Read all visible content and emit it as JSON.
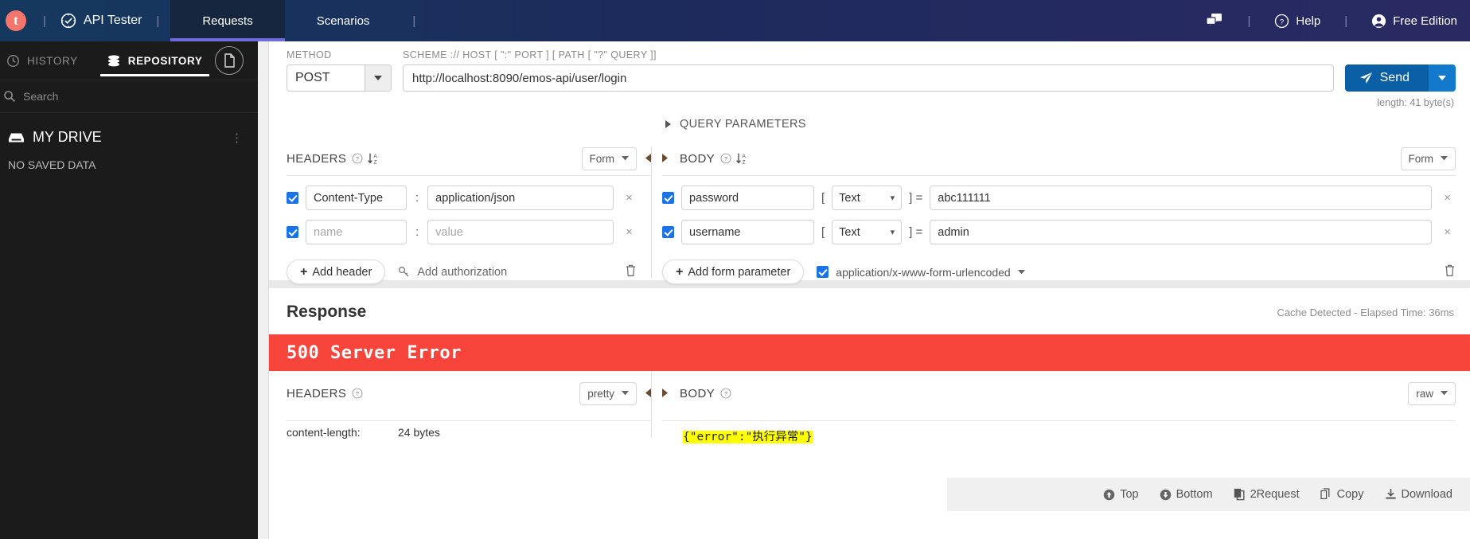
{
  "topnav": {
    "logo_letter": "t",
    "brand": "API Tester",
    "tabs": [
      {
        "label": "Requests",
        "active": true
      },
      {
        "label": "Scenarios",
        "active": false
      }
    ],
    "separator": "|",
    "help_label": "Help",
    "account_label": "Free Edition",
    "chat_icon": "chat-icon",
    "help_icon": "question-circle-icon",
    "account_icon": "user-circle-icon"
  },
  "sidebar": {
    "tabs": [
      {
        "label": "HISTORY",
        "icon": "clock-icon",
        "active": false
      },
      {
        "label": "REPOSITORY",
        "icon": "database-icon",
        "active": true
      }
    ],
    "doc_button_icon": "document-icon",
    "search_placeholder": "Search",
    "search_icon": "search-icon",
    "drive_label": "MY DRIVE",
    "drive_icon": "drive-icon",
    "drive_menu_icon": "kebab-menu-icon",
    "empty_label": "NO SAVED DATA"
  },
  "request": {
    "method_label": "METHOD",
    "method_value": "POST",
    "url_label": "SCHEME :// HOST [ \":\" PORT ] [ PATH [ \"?\" QUERY ]]",
    "url_value": "http://localhost:8090/emos-api/user/login",
    "send_label": "Send",
    "send_icon": "paper-plane-icon",
    "length_note": "length: 41 byte(s)",
    "query_params_label": "QUERY PARAMETERS",
    "query_params_icon": "triangle-right-icon"
  },
  "headers_panel": {
    "title": "HEADERS",
    "help_icon": "question-circle-icon",
    "sort_icon": "sort-az-icon",
    "view_mode": "Form",
    "collapse_icon": "triangle-left-icon",
    "rows": [
      {
        "checked": true,
        "name": "Content-Type",
        "value": "application/json",
        "name_is_placeholder": false,
        "value_is_placeholder": false,
        "remove": "×"
      },
      {
        "checked": true,
        "name": "name",
        "value": "value",
        "name_is_placeholder": true,
        "value_is_placeholder": true,
        "remove": "×"
      }
    ],
    "separator": ":",
    "add_label": "Add header",
    "add_auth_label": "Add authorization",
    "add_auth_icon": "key-icon",
    "trash_icon": "trash-icon"
  },
  "body_panel": {
    "title": "BODY",
    "help_icon": "question-circle-icon",
    "sort_icon": "sort-az-icon",
    "view_mode": "Form",
    "expand_icon": "triangle-right-icon",
    "rows": [
      {
        "checked": true,
        "name": "password",
        "type": "Text",
        "value": "abc111111",
        "remove": "×"
      },
      {
        "checked": true,
        "name": "username",
        "type": "Text",
        "value": "admin",
        "remove": "×"
      }
    ],
    "bracket_open": "[",
    "bracket_close": "] =",
    "add_label": "Add form parameter",
    "content_type_checked": true,
    "content_type": "application/x-www-form-urlencoded",
    "trash_icon": "trash-icon"
  },
  "response": {
    "title": "Response",
    "cache_note": "Cache Detected - Elapsed Time: 36ms",
    "status_banner": "500 Server Error",
    "status_color": "#f8453c",
    "headers": {
      "title": "HEADERS",
      "help_icon": "question-circle-icon",
      "view_mode": "pretty",
      "collapse_icon": "triangle-left-icon",
      "rows": [
        {
          "key": "content-length:",
          "value": "24 bytes"
        }
      ]
    },
    "body": {
      "title": "BODY",
      "help_icon": "question-circle-icon",
      "view_mode": "raw",
      "expand_icon": "triangle-right-icon",
      "content": "{\"error\":\"执行异常\"}"
    },
    "toolbar": [
      {
        "label": "Top",
        "icon": "arrow-up-circle-icon"
      },
      {
        "label": "Bottom",
        "icon": "arrow-down-circle-icon"
      },
      {
        "label": "2Request",
        "icon": "copy-to-request-icon"
      },
      {
        "label": "Copy",
        "icon": "copy-icon"
      },
      {
        "label": "Download",
        "icon": "download-icon"
      }
    ]
  }
}
